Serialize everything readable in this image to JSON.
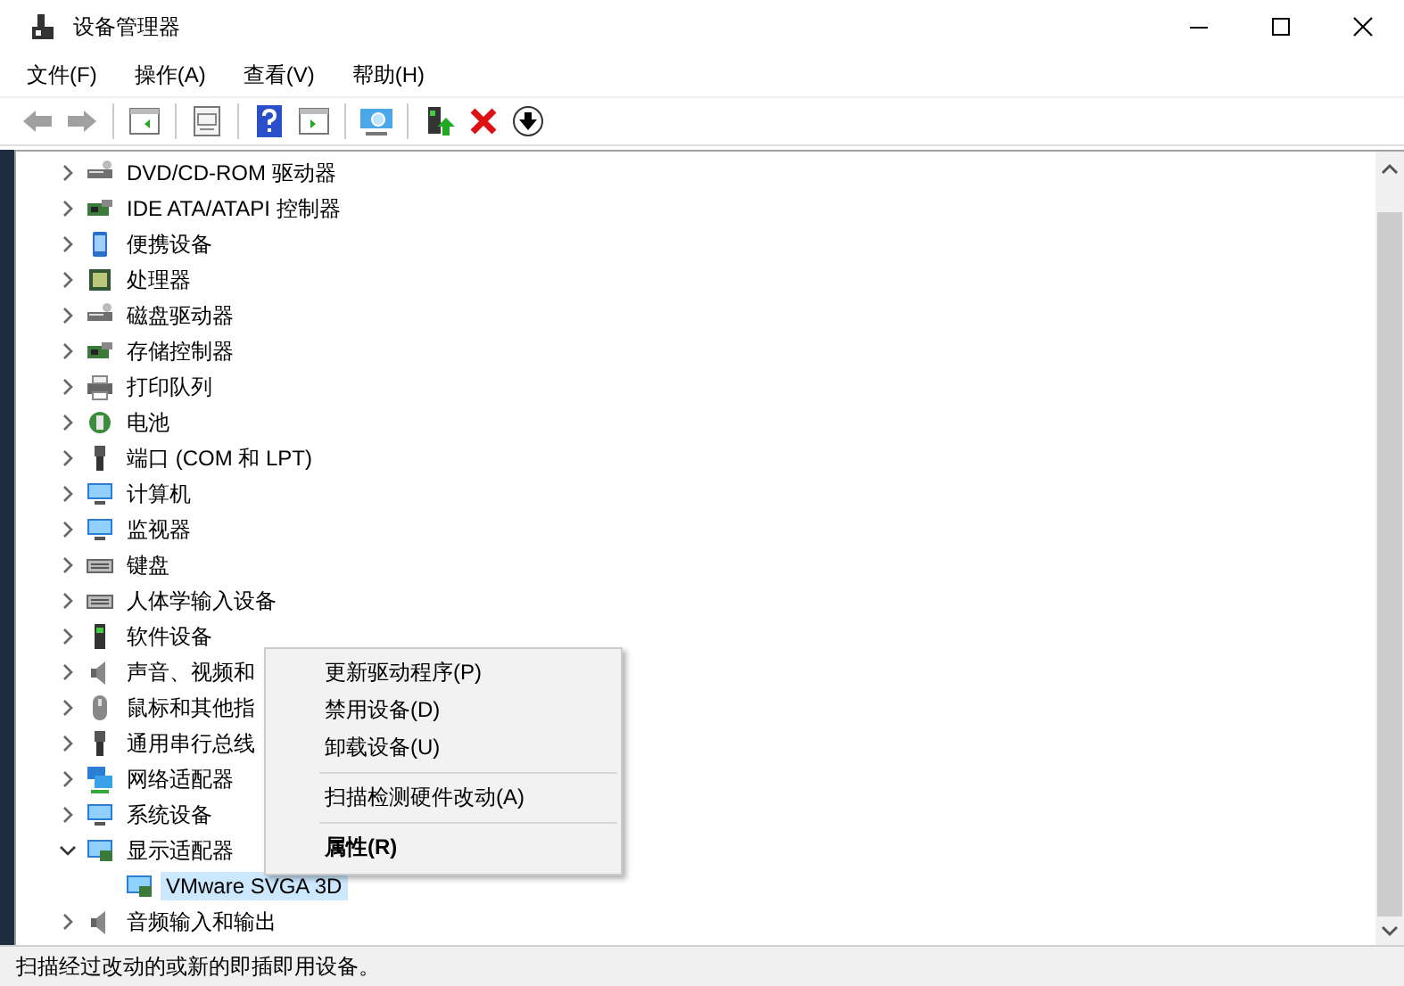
{
  "window": {
    "title": "设备管理器"
  },
  "menu_bar": [
    "文件(F)",
    "操作(A)",
    "查看(V)",
    "帮助(H)"
  ],
  "tree": [
    {
      "label": "DVD/CD-ROM 驱动器",
      "expanded": false
    },
    {
      "label": "IDE ATA/ATAPI 控制器",
      "expanded": false
    },
    {
      "label": "便携设备",
      "expanded": false
    },
    {
      "label": "处理器",
      "expanded": false
    },
    {
      "label": "磁盘驱动器",
      "expanded": false
    },
    {
      "label": "存储控制器",
      "expanded": false
    },
    {
      "label": "打印队列",
      "expanded": false
    },
    {
      "label": "电池",
      "expanded": false
    },
    {
      "label": "端口 (COM 和 LPT)",
      "expanded": false
    },
    {
      "label": "计算机",
      "expanded": false
    },
    {
      "label": "监视器",
      "expanded": false
    },
    {
      "label": "键盘",
      "expanded": false
    },
    {
      "label": "人体学输入设备",
      "expanded": false
    },
    {
      "label": "软件设备",
      "expanded": false
    },
    {
      "label": "声音、视频和",
      "expanded": false
    },
    {
      "label": "鼠标和其他指",
      "expanded": false
    },
    {
      "label": "通用串行总线",
      "expanded": false
    },
    {
      "label": "网络适配器",
      "expanded": false
    },
    {
      "label": "系统设备",
      "expanded": false
    },
    {
      "label": "显示适配器",
      "expanded": true,
      "children": [
        {
          "label": "VMware SVGA 3D",
          "selected": true
        }
      ]
    },
    {
      "label": "音频输入和输出",
      "expanded": false
    }
  ],
  "context_menu": [
    {
      "label": "更新驱动程序(P)",
      "separator_before": false,
      "default": false
    },
    {
      "label": "禁用设备(D)",
      "separator_before": false,
      "default": false
    },
    {
      "label": "卸载设备(U)",
      "separator_before": false,
      "default": false
    },
    {
      "label": "扫描检测硬件改动(A)",
      "separator_before": true,
      "default": false
    },
    {
      "label": "属性(R)",
      "separator_before": true,
      "default": true
    }
  ],
  "status_bar": "扫描经过改动的或新的即插即用设备。"
}
